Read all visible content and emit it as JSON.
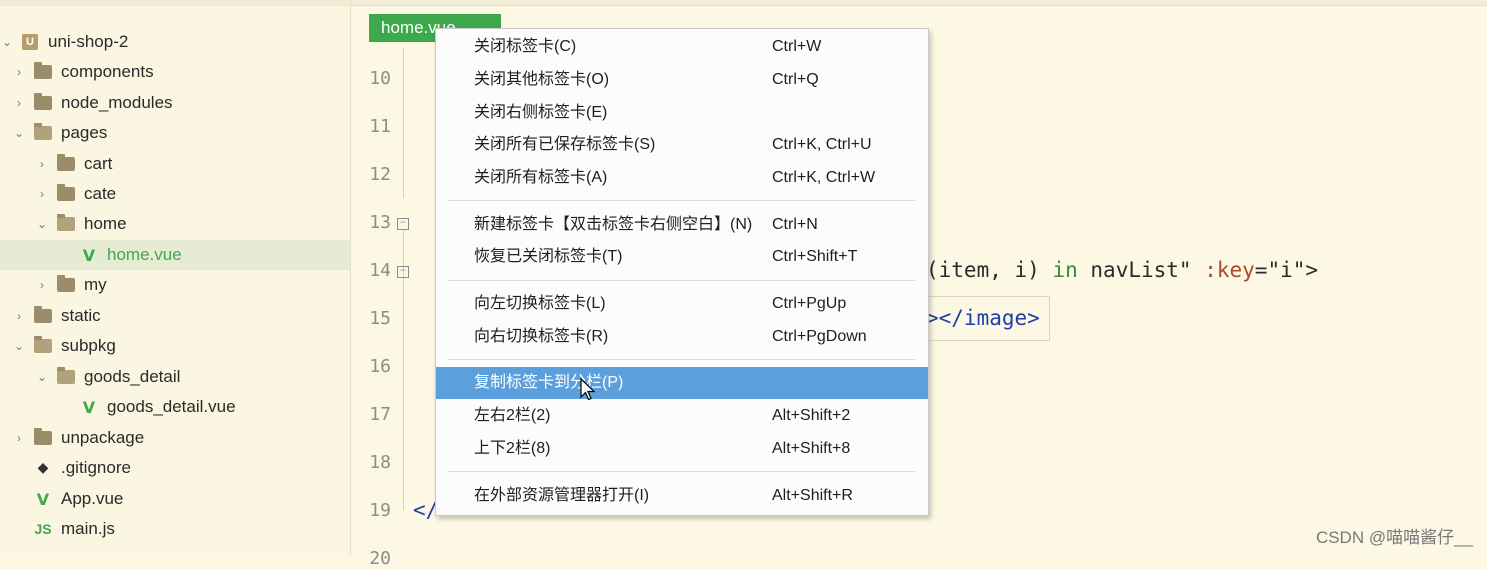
{
  "sidebar": {
    "items": [
      {
        "label": "uni-shop-2",
        "type": "project"
      },
      {
        "label": "components",
        "type": "folder"
      },
      {
        "label": "node_modules",
        "type": "folder"
      },
      {
        "label": "pages",
        "type": "folder-open"
      },
      {
        "label": "cart",
        "type": "folder"
      },
      {
        "label": "cate",
        "type": "folder"
      },
      {
        "label": "home",
        "type": "folder-open"
      },
      {
        "label": "home.vue",
        "type": "vue",
        "selected": true
      },
      {
        "label": "my",
        "type": "folder"
      },
      {
        "label": "static",
        "type": "folder"
      },
      {
        "label": "subpkg",
        "type": "folder-open"
      },
      {
        "label": "goods_detail",
        "type": "folder-open"
      },
      {
        "label": "goods_detail.vue",
        "type": "vue"
      },
      {
        "label": "unpackage",
        "type": "folder"
      },
      {
        "label": ".gitignore",
        "type": "git"
      },
      {
        "label": "App.vue",
        "type": "vue"
      },
      {
        "label": "main.js",
        "type": "js"
      }
    ]
  },
  "editor": {
    "tab_label": "home.vue",
    "line_numbers": [
      "10",
      "11",
      "12",
      "13",
      "14",
      "15",
      "16",
      "17",
      "18",
      "19",
      "20"
    ],
    "code": {
      "line14_a": "(item, i)",
      "line14_kw": "in",
      "line14_b": "navList\"",
      "line14_attr": ":key",
      "line14_c": "=\"i\">",
      "line15_tag": "></image>",
      "line19_tag": "</"
    }
  },
  "context_menu": {
    "items": [
      {
        "label": "关闭标签卡(C)",
        "shortcut": "Ctrl+W"
      },
      {
        "label": "关闭其他标签卡(O)",
        "shortcut": "Ctrl+Q"
      },
      {
        "label": "关闭右侧标签卡(E)",
        "shortcut": ""
      },
      {
        "label": "关闭所有已保存标签卡(S)",
        "shortcut": "Ctrl+K, Ctrl+U"
      },
      {
        "label": "关闭所有标签卡(A)",
        "shortcut": "Ctrl+K, Ctrl+W"
      },
      {
        "label": "新建标签卡【双击标签卡右侧空白】(N)",
        "shortcut": "Ctrl+N"
      },
      {
        "label": "恢复已关闭标签卡(T)",
        "shortcut": "Ctrl+Shift+T"
      },
      {
        "label": "向左切换标签卡(L)",
        "shortcut": "Ctrl+PgUp"
      },
      {
        "label": "向右切换标签卡(R)",
        "shortcut": "Ctrl+PgDown"
      },
      {
        "label": "复制标签卡到分栏(P)",
        "shortcut": "",
        "active": true
      },
      {
        "label": "左右2栏(2)",
        "shortcut": "Alt+Shift+2"
      },
      {
        "label": "上下2栏(8)",
        "shortcut": "Alt+Shift+8"
      },
      {
        "label": "在外部资源管理器打开(I)",
        "shortcut": "Alt+Shift+R"
      }
    ]
  },
  "watermark": "CSDN @喵喵酱仔__",
  "colors": {
    "accent_green": "#3ea84c",
    "menu_highlight": "#5b9fdc",
    "background": "#fdf8e4"
  }
}
